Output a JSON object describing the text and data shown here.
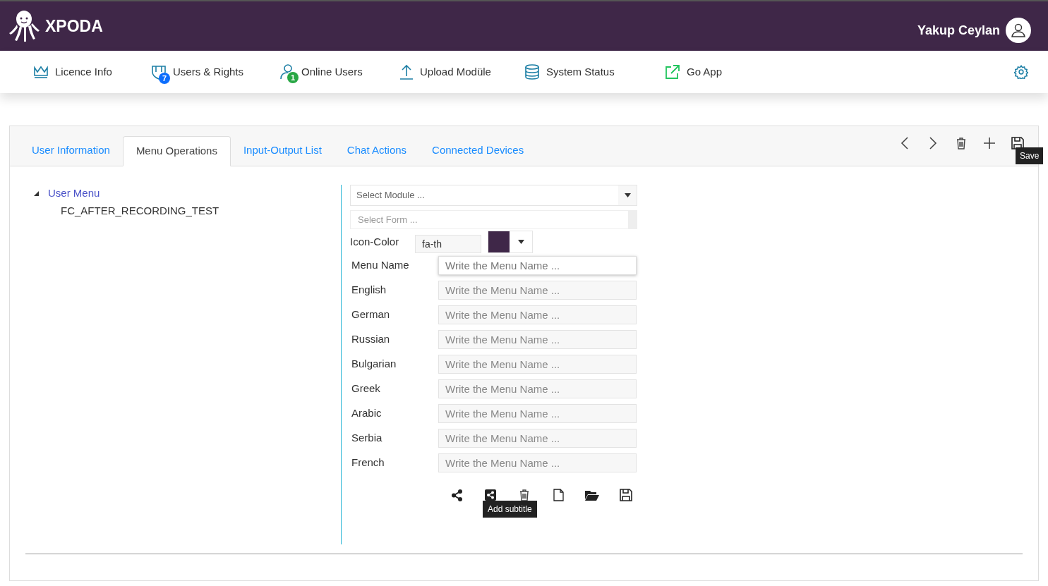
{
  "header": {
    "brand": "XPODA",
    "user": "Yakup Ceylan"
  },
  "nav": [
    {
      "kind": "crown",
      "label": "Licence Info"
    },
    {
      "kind": "shield",
      "label": "Users & Rights",
      "badge": {
        "text": "7",
        "color": "#0d6efd"
      }
    },
    {
      "kind": "user",
      "label": "Online Users",
      "badge": {
        "text": "1",
        "color": "#28a745"
      }
    },
    {
      "kind": "upload",
      "label": "Upload Modüle"
    },
    {
      "kind": "database",
      "label": "System Status"
    },
    {
      "kind": "external",
      "label": "Go App"
    }
  ],
  "tabs": [
    {
      "label": "User Information",
      "selected": false
    },
    {
      "label": "Menu Operations",
      "selected": true
    },
    {
      "label": "Input-Output List",
      "selected": false
    },
    {
      "label": "Chat Actions",
      "selected": false
    },
    {
      "label": "Connected Devices",
      "selected": false
    }
  ],
  "toolbar": [
    {
      "kind": "prev"
    },
    {
      "kind": "next"
    },
    {
      "kind": "delete"
    },
    {
      "kind": "add"
    },
    {
      "kind": "save",
      "tooltip": "Save"
    }
  ],
  "tree": [
    {
      "label": "User Menu",
      "expanded": true,
      "children": [
        {
          "label": "FC_AFTER_RECORDING_TEST"
        }
      ]
    }
  ],
  "form": {
    "module_select": {
      "placeholder": "Select Module ..."
    },
    "form_select": {
      "placeholder": "Select Form ..."
    },
    "icon_color": {
      "label": "Icon-Color",
      "value": "fa-th",
      "color": "#3f2748"
    },
    "fields": [
      {
        "label": "Menu Name",
        "placeholder": "Write the Menu Name ...",
        "focused": true
      },
      {
        "label": "English",
        "placeholder": "Write the Menu Name ...",
        "focused": false
      },
      {
        "label": "German",
        "placeholder": "Write the Menu Name ...",
        "focused": false
      },
      {
        "label": "Russian",
        "placeholder": "Write the Menu Name ...",
        "focused": false
      },
      {
        "label": "Bulgarian",
        "placeholder": "Write the Menu Name ...",
        "focused": false
      },
      {
        "label": "Greek",
        "placeholder": "Write the Menu Name ...",
        "focused": false
      },
      {
        "label": "Arabic",
        "placeholder": "Write the Menu Name ...",
        "focused": false
      },
      {
        "label": "Serbia",
        "placeholder": "Write the Menu Name ...",
        "focused": false
      },
      {
        "label": "French",
        "placeholder": "Write the Menu Name ...",
        "focused": false
      }
    ],
    "actions": [
      {
        "kind": "share"
      },
      {
        "kind": "share-square",
        "tooltip": "Add subtitle"
      },
      {
        "kind": "delete"
      },
      {
        "kind": "file"
      },
      {
        "kind": "folder"
      },
      {
        "kind": "save"
      }
    ]
  }
}
